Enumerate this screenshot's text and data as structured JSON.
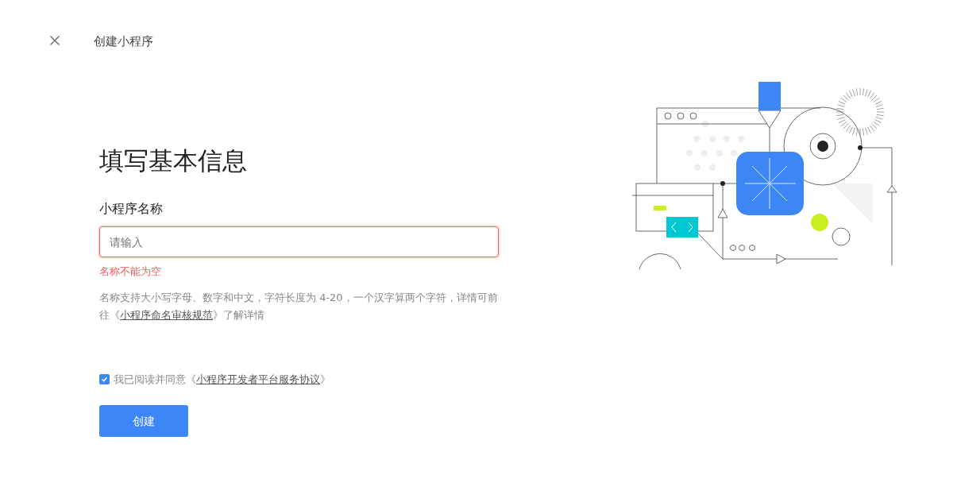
{
  "header": {
    "title": "创建小程序"
  },
  "heading": "填写基本信息",
  "name_field": {
    "label": "小程序名称",
    "placeholder": "请输入",
    "error": "名称不能为空",
    "hint_before": "名称支持大小写字母、数字和中文，字符长度为 4-20，一个汉字算两个字符，详情可前往《",
    "hint_link": "小程序命名审核规范",
    "hint_after": "》了解详情"
  },
  "agreement": {
    "checked": true,
    "text": "我已阅读并同意《",
    "link": "小程序开发者平台服务协议",
    "text_after": "》"
  },
  "submit_button": "创建"
}
